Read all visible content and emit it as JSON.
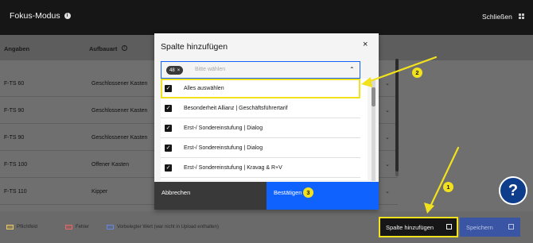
{
  "header": {
    "title": "Fokus-Modus",
    "close_label": "Schließen"
  },
  "table": {
    "columns": [
      "Angaben",
      "Aufbauart"
    ],
    "rows": [
      {
        "angaben": "F-TS 60",
        "aufbauart": "Geschlossener Kasten"
      },
      {
        "angaben": "F-TS 90",
        "aufbauart": "Geschlossener Kasten"
      },
      {
        "angaben": "F-TS 90",
        "aufbauart": "Geschlossener Kasten"
      },
      {
        "angaben": "F-TS 100",
        "aufbauart": "Offener Kasten"
      },
      {
        "angaben": "F-TS 110",
        "aufbauart": "Kipper"
      }
    ]
  },
  "footer": {
    "legend": [
      {
        "label": "Pflichtfeld",
        "color": "#e7c96a"
      },
      {
        "label": "Fehler",
        "color": "#e06a6a"
      },
      {
        "label": "Vorbelegter Wert (war nicht in Upload enthalten)",
        "color": "#6a8ad8"
      }
    ],
    "add_column_label": "Spalte hinzufügen",
    "save_label": "Speichern"
  },
  "help": {
    "label": "?"
  },
  "modal": {
    "title": "Spalte hinzufügen",
    "close_glyph": "×",
    "selected_count": "48",
    "tag_close_glyph": "×",
    "placeholder": "Bitte wählen",
    "options": [
      {
        "label": "Alles auswählen",
        "checked": true
      },
      {
        "label": "Besonderheit Allianz | Geschäftsführertarif",
        "checked": true
      },
      {
        "label": "Erst-/ Sondereinstufung | Dialog",
        "checked": true
      },
      {
        "label": "Erst-/ Sondereinstufung | Dialog",
        "checked": true
      },
      {
        "label": "Erst-/ Sondereinstufung | Kravag & R+V",
        "checked": true
      }
    ],
    "cancel_label": "Abbrechen",
    "confirm_label": "Bestätigen"
  },
  "annotations": {
    "marker_1": "1",
    "marker_2": "2",
    "marker_3": "3",
    "color": "#f2e11d"
  }
}
